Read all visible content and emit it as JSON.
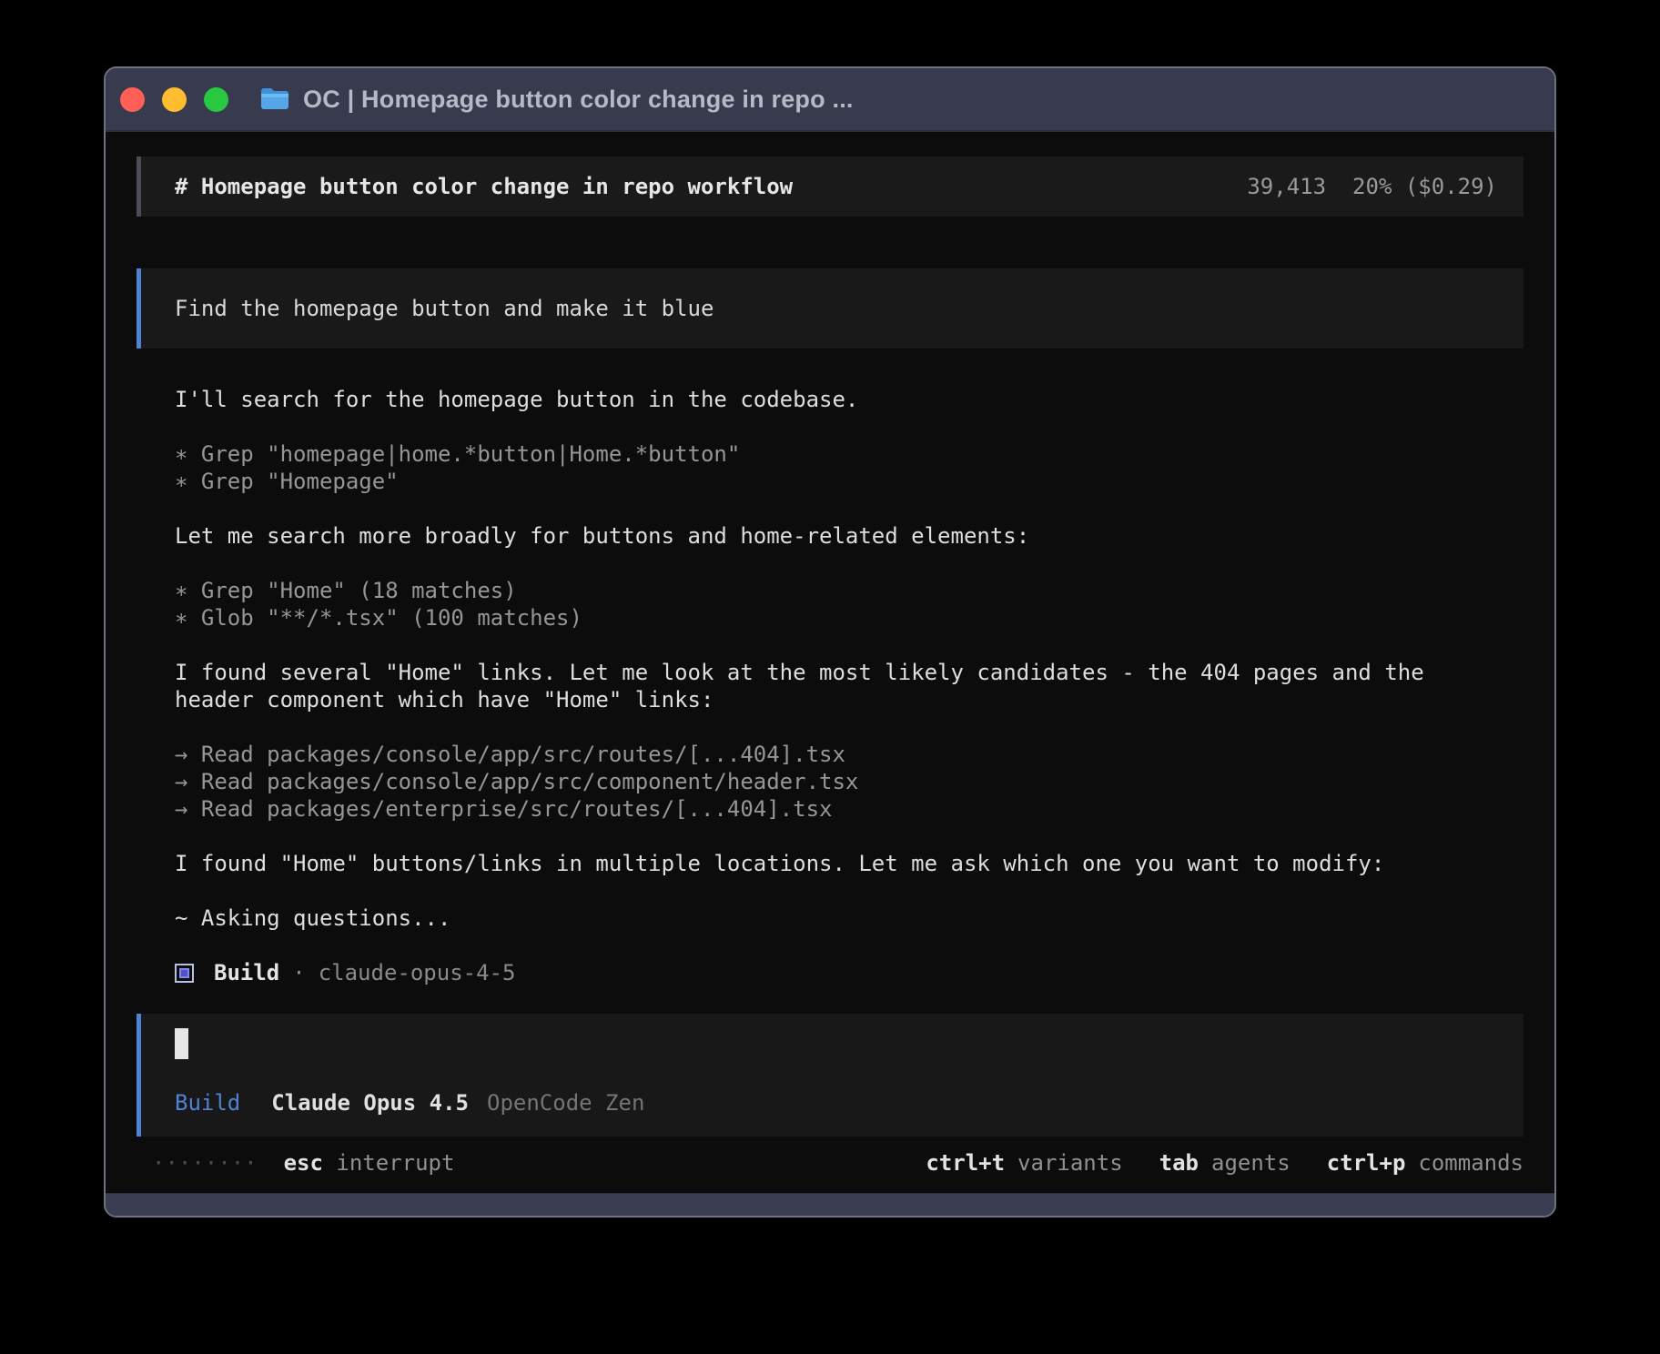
{
  "window": {
    "title": "OC | Homepage button color change in repo ..."
  },
  "session": {
    "title": "# Homepage button color change in repo workflow",
    "tokens": "39,413",
    "context_cost": "20% ($0.29)"
  },
  "user_message": {
    "text": "Find the homepage button and make it blue"
  },
  "conversation": {
    "lines": [
      {
        "kind": "text",
        "text": "I'll search for the homepage button in the codebase."
      },
      {
        "kind": "blank"
      },
      {
        "kind": "tool",
        "bullet": "∗",
        "text": "Grep \"homepage|home.*button|Home.*button\""
      },
      {
        "kind": "tool",
        "bullet": "∗",
        "text": "Grep \"Homepage\""
      },
      {
        "kind": "blank"
      },
      {
        "kind": "text",
        "text": "Let me search more broadly for buttons and home-related elements:"
      },
      {
        "kind": "blank"
      },
      {
        "kind": "tool",
        "bullet": "∗",
        "text": "Grep \"Home\" (18 matches)"
      },
      {
        "kind": "tool",
        "bullet": "∗",
        "text": "Glob \"**/*.tsx\" (100 matches)"
      },
      {
        "kind": "blank"
      },
      {
        "kind": "text",
        "text": "I found several \"Home\" links. Let me look at the most likely candidates - the 404 pages and the"
      },
      {
        "kind": "text",
        "text": "header component which have \"Home\" links:"
      },
      {
        "kind": "blank"
      },
      {
        "kind": "tool",
        "bullet": "→",
        "text": "Read packages/console/app/src/routes/[...404].tsx"
      },
      {
        "kind": "tool",
        "bullet": "→",
        "text": "Read packages/console/app/src/component/header.tsx"
      },
      {
        "kind": "tool",
        "bullet": "→",
        "text": "Read packages/enterprise/src/routes/[...404].tsx"
      },
      {
        "kind": "blank"
      },
      {
        "kind": "text",
        "text": "I found \"Home\" buttons/links in multiple locations. Let me ask which one you want to modify:"
      },
      {
        "kind": "blank"
      },
      {
        "kind": "text",
        "text": "~ Asking questions..."
      },
      {
        "kind": "blank"
      }
    ]
  },
  "agent_badge": {
    "name": "Build",
    "separator": "·",
    "model": "claude-opus-4-5"
  },
  "input": {
    "mode": "Build",
    "model": "Claude Opus 4.5",
    "provider": "OpenCode Zen"
  },
  "statusbar": {
    "spinner": "········",
    "left": {
      "key": "esc",
      "label": "interrupt"
    },
    "shortcuts": [
      {
        "key": "ctrl+t",
        "label": "variants"
      },
      {
        "key": "tab",
        "label": "agents"
      },
      {
        "key": "ctrl+p",
        "label": "commands"
      }
    ]
  },
  "colors": {
    "accent_blue": "#4e82d2",
    "agent_indigo": "#4d52cc",
    "traffic_red": "#ff5f57",
    "traffic_yellow": "#febc2e",
    "traffic_green": "#28c840",
    "folder_blue": "#55a6e8",
    "chrome": "#373b4d"
  }
}
